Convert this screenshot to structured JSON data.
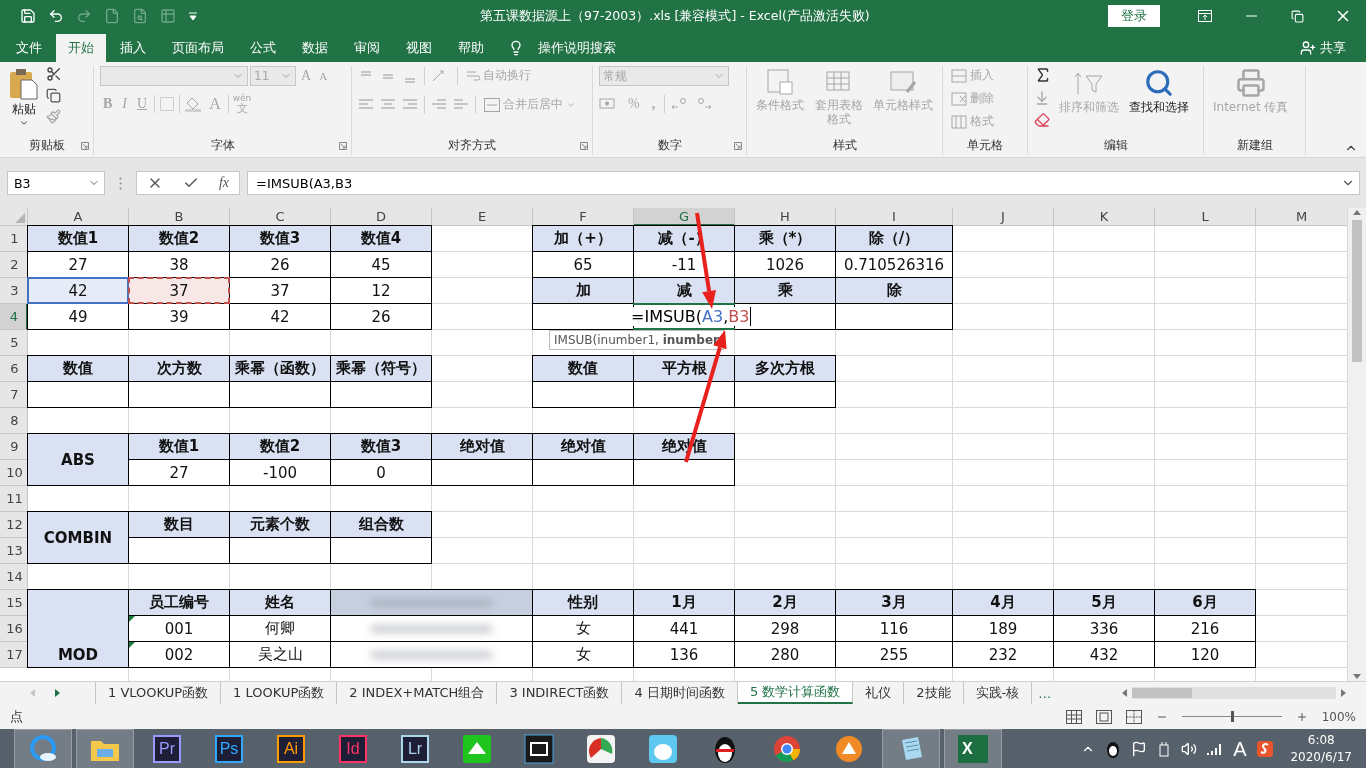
{
  "title_bar": {
    "quick_access": [
      {
        "kind": "save",
        "disabled": false
      },
      {
        "kind": "undo",
        "disabled": false
      },
      {
        "kind": "redo",
        "disabled": true
      },
      {
        "kind": "new",
        "disabled": true
      },
      {
        "kind": "preview",
        "disabled": true
      },
      {
        "kind": "layout",
        "disabled": true
      },
      {
        "kind": "customize",
        "disabled": false
      }
    ],
    "title": "第五课数据源上（97-2003）.xls  [兼容模式]  -  Excel(产品激活失败)",
    "sign_in": "登录"
  },
  "menu": {
    "tabs": [
      {
        "label": "文件",
        "selected": false
      },
      {
        "label": "开始",
        "selected": true
      },
      {
        "label": "插入",
        "selected": false
      },
      {
        "label": "页面布局",
        "selected": false
      },
      {
        "label": "公式",
        "selected": false
      },
      {
        "label": "数据",
        "selected": false
      },
      {
        "label": "审阅",
        "selected": false
      },
      {
        "label": "视图",
        "selected": false
      },
      {
        "label": "帮助",
        "selected": false
      }
    ],
    "tell_me": "操作说明搜索",
    "share": "共享"
  },
  "ribbon": {
    "clipboard": {
      "label": "剪贴板",
      "paste": "粘贴",
      "disabled": false
    },
    "font": {
      "label": "字体",
      "size": "11",
      "grow": "A",
      "shrink": "A",
      "bold": "B",
      "italic": "I",
      "underline": "U",
      "font_color_glyph": "A",
      "phonetic_top": "wén",
      "phonetic_bottom": "文",
      "disabled": true
    },
    "alignment": {
      "label": "对齐方式",
      "wrap": "自动换行",
      "merge": "合并后居中",
      "disabled": true
    },
    "number": {
      "label": "数字",
      "format": "常规",
      "percent": "%",
      "comma": ",",
      "disabled": true
    },
    "styles": {
      "label": "样式",
      "items": [
        {
          "kind": "conditional",
          "label": "条件格式",
          "disabled": true
        },
        {
          "kind": "table",
          "label": "套用表格格式",
          "disabled": true
        },
        {
          "kind": "cell",
          "label": "单元格样式",
          "disabled": true
        }
      ]
    },
    "cells": {
      "label": "单元格",
      "items": [
        {
          "kind": "insert",
          "label": "插入",
          "disabled": true
        },
        {
          "kind": "delete",
          "label": "删除",
          "disabled": true
        },
        {
          "kind": "format",
          "label": "格式",
          "disabled": true
        }
      ]
    },
    "editing": {
      "label": "编辑",
      "items": [
        {
          "kind": "sort",
          "label": "排序和筛选",
          "disabled": true
        },
        {
          "kind": "find",
          "label": "查找和选择",
          "disabled": false
        }
      ]
    },
    "new_group": {
      "label": "新建组",
      "fax": "Internet 传真",
      "disabled": true
    }
  },
  "formula_bar": {
    "name_box": "B3",
    "fx": "fx",
    "formula": "=IMSUB(A3,B3"
  },
  "sheet": {
    "columns": [
      {
        "label": "A",
        "selected": false
      },
      {
        "label": "B",
        "selected": false
      },
      {
        "label": "C",
        "selected": false
      },
      {
        "label": "D",
        "selected": false
      },
      {
        "label": "E",
        "selected": false
      },
      {
        "label": "F",
        "selected": false
      },
      {
        "label": "G",
        "selected": true
      },
      {
        "label": "H",
        "selected": false
      },
      {
        "label": "I",
        "selected": false
      },
      {
        "label": "J",
        "selected": false
      },
      {
        "label": "K",
        "selected": false
      },
      {
        "label": "L",
        "selected": false
      },
      {
        "label": "M",
        "selected": false
      }
    ],
    "rows": [
      {
        "number": "1",
        "selected": false,
        "cells": [
          {
            "kind": "header",
            "text": "数值1"
          },
          {
            "kind": "header",
            "text": "数值2"
          },
          {
            "kind": "header",
            "text": "数值3"
          },
          {
            "kind": "header",
            "text": "数值4"
          },
          null,
          {
            "kind": "header",
            "text": "加（+）"
          },
          {
            "kind": "header",
            "text": "减（-）"
          },
          {
            "kind": "header",
            "text": "乘（*）"
          },
          {
            "kind": "header",
            "text": "除（/）"
          }
        ]
      },
      {
        "number": "2",
        "selected": false,
        "cells": [
          {
            "kind": "value",
            "text": "27"
          },
          {
            "kind": "value",
            "text": "38"
          },
          {
            "kind": "value",
            "text": "26"
          },
          {
            "kind": "value",
            "text": "45"
          },
          null,
          {
            "kind": "value",
            "text": "65"
          },
          {
            "kind": "value",
            "text": "-11"
          },
          {
            "kind": "value",
            "text": "1026"
          },
          {
            "kind": "value",
            "text": "0.710526316"
          }
        ]
      },
      {
        "number": "3",
        "selected": false,
        "cells": [
          {
            "kind": "value",
            "text": "42",
            "color": "#4472c4",
            "active_ref": false
          },
          {
            "kind": "value",
            "text": "37",
            "color": "#c0504d",
            "active_ref": true
          },
          {
            "kind": "value",
            "text": "37"
          },
          {
            "kind": "value",
            "text": "12"
          },
          null,
          {
            "kind": "header",
            "text": "加"
          },
          {
            "kind": "header",
            "text": "减"
          },
          {
            "kind": "header",
            "text": "乘"
          },
          {
            "kind": "header",
            "text": "除"
          }
        ]
      },
      {
        "number": "4",
        "selected": true,
        "cells": [
          {
            "kind": "value",
            "text": "49"
          },
          {
            "kind": "value",
            "text": "39"
          },
          {
            "kind": "value",
            "text": "42"
          },
          {
            "kind": "value",
            "text": "26"
          },
          null,
          {
            "kind": "blank"
          },
          {
            "kind": "editing",
            "parts": [
              {
                "text": "=IMSUB("
              },
              {
                "text": "A3",
                "color": "#4472c4"
              },
              {
                "text": ","
              },
              {
                "text": "B3",
                "color": "#c0504d"
              }
            ],
            "tooltip": "IMSUB(inumber1, **inumber**"
          },
          {
            "kind": "blank"
          },
          {
            "kind": "blank"
          }
        ]
      },
      {
        "number": "5",
        "selected": false,
        "cells": []
      },
      {
        "number": "6",
        "selected": false,
        "cells": [
          {
            "kind": "header",
            "text": "数值"
          },
          {
            "kind": "header",
            "text": "次方数"
          },
          {
            "kind": "header",
            "text": "乘幂（函数）"
          },
          {
            "kind": "header",
            "text": "乘幂（符号）"
          },
          null,
          {
            "kind": "header",
            "text": "数值"
          },
          {
            "kind": "header",
            "text": "平方根"
          },
          {
            "kind": "header",
            "text": "多次方根"
          }
        ]
      },
      {
        "number": "7",
        "selected": false,
        "cells": [
          {
            "kind": "blank"
          },
          {
            "kind": "blank"
          },
          {
            "kind": "blank"
          },
          {
            "kind": "blank"
          },
          null,
          {
            "kind": "blank"
          },
          {
            "kind": "blank"
          },
          {
            "kind": "blank"
          }
        ]
      },
      {
        "number": "8",
        "selected": false,
        "cells": []
      },
      {
        "number": "9",
        "selected": false,
        "cells": [
          {
            "kind": "label",
            "text": "ABS"
          },
          {
            "kind": "header",
            "text": "数值1"
          },
          {
            "kind": "header",
            "text": "数值2"
          },
          {
            "kind": "header",
            "text": "数值3"
          },
          {
            "kind": "header",
            "text": "绝对值"
          },
          {
            "kind": "header",
            "text": "绝对值"
          },
          {
            "kind": "header",
            "text": "绝对值"
          }
        ]
      },
      {
        "number": "10",
        "selected": false,
        "cells": [
          {
            "kind": "covered"
          },
          {
            "kind": "value",
            "text": "27"
          },
          {
            "kind": "value",
            "text": "-100"
          },
          {
            "kind": "value",
            "text": "0"
          },
          {
            "kind": "blank"
          },
          {
            "kind": "blank"
          },
          {
            "kind": "blank"
          }
        ]
      },
      {
        "number": "11",
        "selected": false,
        "cells": []
      },
      {
        "number": "12",
        "selected": false,
        "cells": [
          {
            "kind": "label",
            "text": "COMBIN"
          },
          {
            "kind": "header",
            "text": "数目"
          },
          {
            "kind": "header",
            "text": "元素个数"
          },
          {
            "kind": "header",
            "text": "组合数"
          }
        ]
      },
      {
        "number": "13",
        "selected": false,
        "cells": [
          {
            "kind": "covered"
          },
          {
            "kind": "blank"
          },
          {
            "kind": "blank"
          },
          {
            "kind": "blank"
          }
        ]
      },
      {
        "number": "14",
        "selected": false,
        "cells": []
      },
      {
        "number": "15",
        "selected": false,
        "cells": [
          {
            "kind": "covered"
          },
          {
            "kind": "header",
            "text": "员工编号"
          },
          {
            "kind": "header",
            "text": "姓名"
          },
          {
            "kind": "blurred-header"
          },
          {
            "kind": "covered"
          },
          {
            "kind": "header",
            "text": "性别"
          },
          {
            "kind": "header",
            "text": "1月"
          },
          {
            "kind": "header",
            "text": "2月"
          },
          {
            "kind": "header",
            "text": "3月"
          },
          {
            "kind": "header",
            "text": "4月"
          },
          {
            "kind": "header",
            "text": "5月"
          },
          {
            "kind": "header",
            "text": "6月"
          }
        ]
      },
      {
        "number": "16",
        "selected": false,
        "cells": [
          {
            "kind": "covered"
          },
          {
            "kind": "value",
            "text": "001",
            "warning": true
          },
          {
            "kind": "value",
            "text": "何卿"
          },
          {
            "kind": "blurred"
          },
          {
            "kind": "covered"
          },
          {
            "kind": "value",
            "text": "女"
          },
          {
            "kind": "value",
            "text": "441"
          },
          {
            "kind": "value",
            "text": "298"
          },
          {
            "kind": "value",
            "text": "116"
          },
          {
            "kind": "value",
            "text": "189"
          },
          {
            "kind": "value",
            "text": "336"
          },
          {
            "kind": "value",
            "text": "216"
          }
        ]
      },
      {
        "number": "17",
        "selected": false,
        "cells": [
          {
            "kind": "label",
            "text": "MOD"
          },
          {
            "kind": "value",
            "text": "002",
            "warning": true
          },
          {
            "kind": "value",
            "text": "吴之山"
          },
          {
            "kind": "blurred"
          },
          {
            "kind": "covered"
          },
          {
            "kind": "value",
            "text": "女"
          },
          {
            "kind": "value",
            "text": "136"
          },
          {
            "kind": "value",
            "text": "280"
          },
          {
            "kind": "value",
            "text": "255"
          },
          {
            "kind": "value",
            "text": "232"
          },
          {
            "kind": "value",
            "text": "432"
          },
          {
            "kind": "value",
            "text": "120"
          }
        ]
      }
    ]
  },
  "sheet_tabs": {
    "tabs": [
      {
        "label": "1 VLOOKUP函数",
        "selected": false
      },
      {
        "label": "1 LOOKUP函数",
        "selected": false
      },
      {
        "label": "2 INDEX+MATCH组合",
        "selected": false
      },
      {
        "label": "3 INDIRECT函数",
        "selected": false
      },
      {
        "label": "4 日期时间函数",
        "selected": false
      },
      {
        "label": "5 数学计算函数",
        "selected": true
      },
      {
        "label": "礼仪",
        "selected": false
      },
      {
        "label": "2技能",
        "selected": false
      },
      {
        "label": "实践-核",
        "selected": false
      }
    ],
    "more": "…"
  },
  "status_bar": {
    "mode": "点",
    "zoom": {
      "level": 0.5,
      "reading": "100%"
    }
  },
  "taskbar": {
    "apps": [
      {
        "kind": "browser",
        "running": true
      },
      {
        "kind": "folder",
        "running": true
      },
      {
        "kind": "tile",
        "label": "Pr",
        "color": "#9999ff",
        "running": false
      },
      {
        "kind": "tile",
        "label": "Ps",
        "color": "#31a8ff",
        "running": false
      },
      {
        "kind": "tile",
        "label": "Ai",
        "color": "#ff9a00",
        "running": false
      },
      {
        "kind": "tile",
        "label": "Id",
        "color": "#ff3366",
        "running": false
      },
      {
        "kind": "tile",
        "label": "Lr",
        "color": "#add5ec",
        "running": false
      },
      {
        "kind": "green",
        "running": false
      },
      {
        "kind": "film",
        "running": false
      },
      {
        "kind": "chart",
        "running": false
      },
      {
        "kind": "cartoon",
        "running": false
      },
      {
        "kind": "penguin",
        "running": false
      },
      {
        "kind": "chrome",
        "running": false
      },
      {
        "kind": "fox",
        "running": false
      },
      {
        "kind": "notepad",
        "running": true
      },
      {
        "kind": "excel",
        "label": "X",
        "running": true
      }
    ],
    "tray": {
      "ime": "A",
      "time": "6:08",
      "date": "2020/6/17"
    }
  }
}
